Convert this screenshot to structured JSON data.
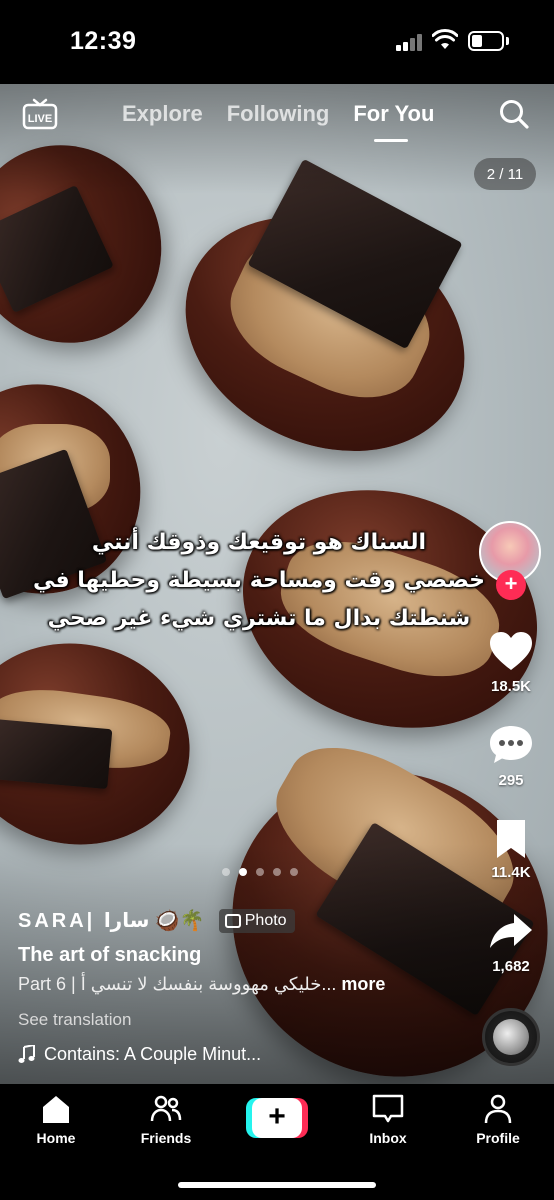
{
  "status_bar": {
    "time": "12:39"
  },
  "top_nav": {
    "live_label": "LIVE",
    "tabs": [
      {
        "label": "Explore",
        "active": false
      },
      {
        "label": "Following",
        "active": false
      },
      {
        "label": "For You",
        "active": true
      }
    ]
  },
  "carousel": {
    "counter": "2 / 11",
    "dot_count": 5,
    "active_dot": 1
  },
  "overlay_caption": {
    "lines": [
      "السناك هو توقيعك وذوقك أنتي",
      "خصصي وقت ومساحة بسيطة وحطيها في",
      "شنطتك بدال ما تشتري شيء غير صحي"
    ]
  },
  "actions": {
    "likes": "18.5K",
    "comments": "295",
    "saves": "11.4K",
    "shares": "1,682"
  },
  "post": {
    "author": "SARA| سارا 🥥🌴",
    "type_badge": "Photo",
    "title": "The art of snacking",
    "description_prefix": "Part 6 | خليكي مهووسة بنفسك لا تنسي أ...",
    "more_label": "more",
    "see_translation": "See translation",
    "sound": "Contains: A Couple Minut..."
  },
  "bottom_nav": {
    "items": [
      {
        "label": "Home",
        "icon": "home-icon"
      },
      {
        "label": "Friends",
        "icon": "friends-icon"
      },
      {
        "label": "Inbox",
        "icon": "inbox-icon"
      },
      {
        "label": "Profile",
        "icon": "profile-icon"
      }
    ]
  },
  "colors": {
    "accent": "#fe2c55",
    "cyan": "#25f4ee",
    "background": "#000000"
  }
}
